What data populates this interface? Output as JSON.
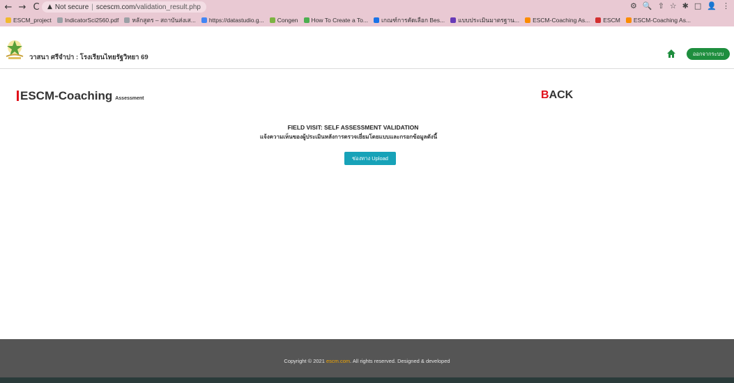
{
  "browser": {
    "nav": {
      "back": "←",
      "forward": "→",
      "reload": "C"
    },
    "security_label": "Not secure",
    "domain": "scescm.com",
    "path": "/validation_result.php",
    "right_icons": [
      "⚙",
      "🔍",
      "⇧",
      "☆",
      "✱",
      "□",
      "👤",
      "⋮"
    ]
  },
  "bookmarks": [
    {
      "label": "ESCM_project",
      "color": "#f2b92d"
    },
    {
      "label": "IndicatorSci2560.pdf",
      "color": "#9aa0a6"
    },
    {
      "label": "หลักสูตร – สถาบันส่งเส...",
      "color": "#9aa0a6"
    },
    {
      "label": "https://datastudio.g...",
      "color": "#4285f4"
    },
    {
      "label": "Congen",
      "color": "#7cb342"
    },
    {
      "label": "How To Create a To...",
      "color": "#4caf50"
    },
    {
      "label": "เกณฑ์การคัดเลือก Bes...",
      "color": "#1a73e8"
    },
    {
      "label": "แบบประเมินมาตรฐาน...",
      "color": "#673ab7"
    },
    {
      "label": "ESCM-Coaching As...",
      "color": "#fb8c00"
    },
    {
      "label": "ESCM",
      "color": "#d32f2f"
    },
    {
      "label": "ESCM-Coaching As...",
      "color": "#fb8c00"
    }
  ],
  "header": {
    "school_name": "วาสนา ศรีจำปา : โรงเรียนไทยรัฐวิทยา 69",
    "logout_label": "ออกจากระบบ",
    "accent": "#1e8e3e"
  },
  "brand": {
    "title": "ESCM-Coaching",
    "subtitle": "Assessment",
    "back_first": "B",
    "back_rest": "ACK"
  },
  "main": {
    "title": "FIELD VISIT: SELF ASSESSMENT VALIDATION",
    "subtitle": "แจ้งความเห็นของผู้ประเมินหลังการตรวจเยี่ยมโดยแบบและกรอกข้อมูลดังนี้",
    "upload_label": "ช่องทาง Upload"
  },
  "footer": {
    "prefix": "Copyright © 2021",
    "link": "escm.com",
    "suffix": ". All rights reserved. Designed & developed"
  }
}
